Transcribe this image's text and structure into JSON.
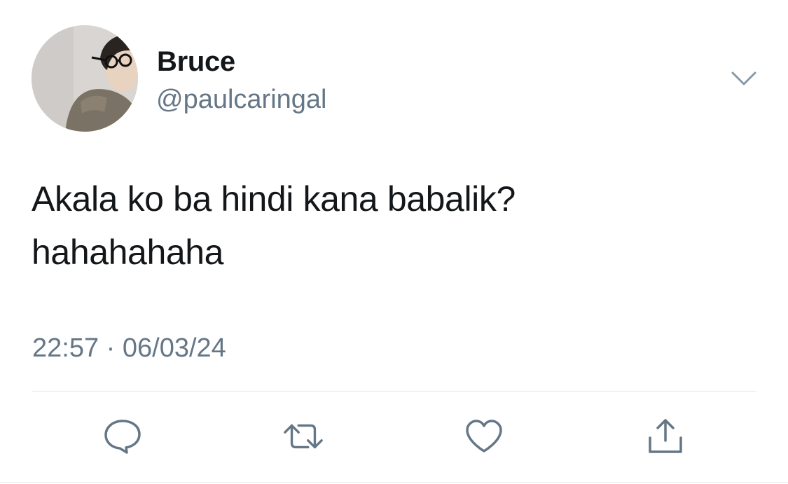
{
  "tweet": {
    "user": {
      "display_name": "Bruce",
      "handle": "@paulcaringal",
      "avatar_icon": "profile-photo"
    },
    "text_lines": [
      "Akala ko ba hindi kana babalik?",
      "hahahahaha"
    ],
    "timestamp": "22:57 · 06/03/24",
    "menu_icon": "chevron-down-icon",
    "actions": [
      {
        "name": "reply",
        "icon": "speech-bubble-icon"
      },
      {
        "name": "retweet",
        "icon": "retweet-arrows-icon"
      },
      {
        "name": "like",
        "icon": "heart-icon"
      },
      {
        "name": "share",
        "icon": "share-upload-icon"
      }
    ],
    "colors": {
      "text": "#14171a",
      "secondary": "#657786",
      "divider": "#e1e8ed",
      "icon": "#657786"
    }
  }
}
